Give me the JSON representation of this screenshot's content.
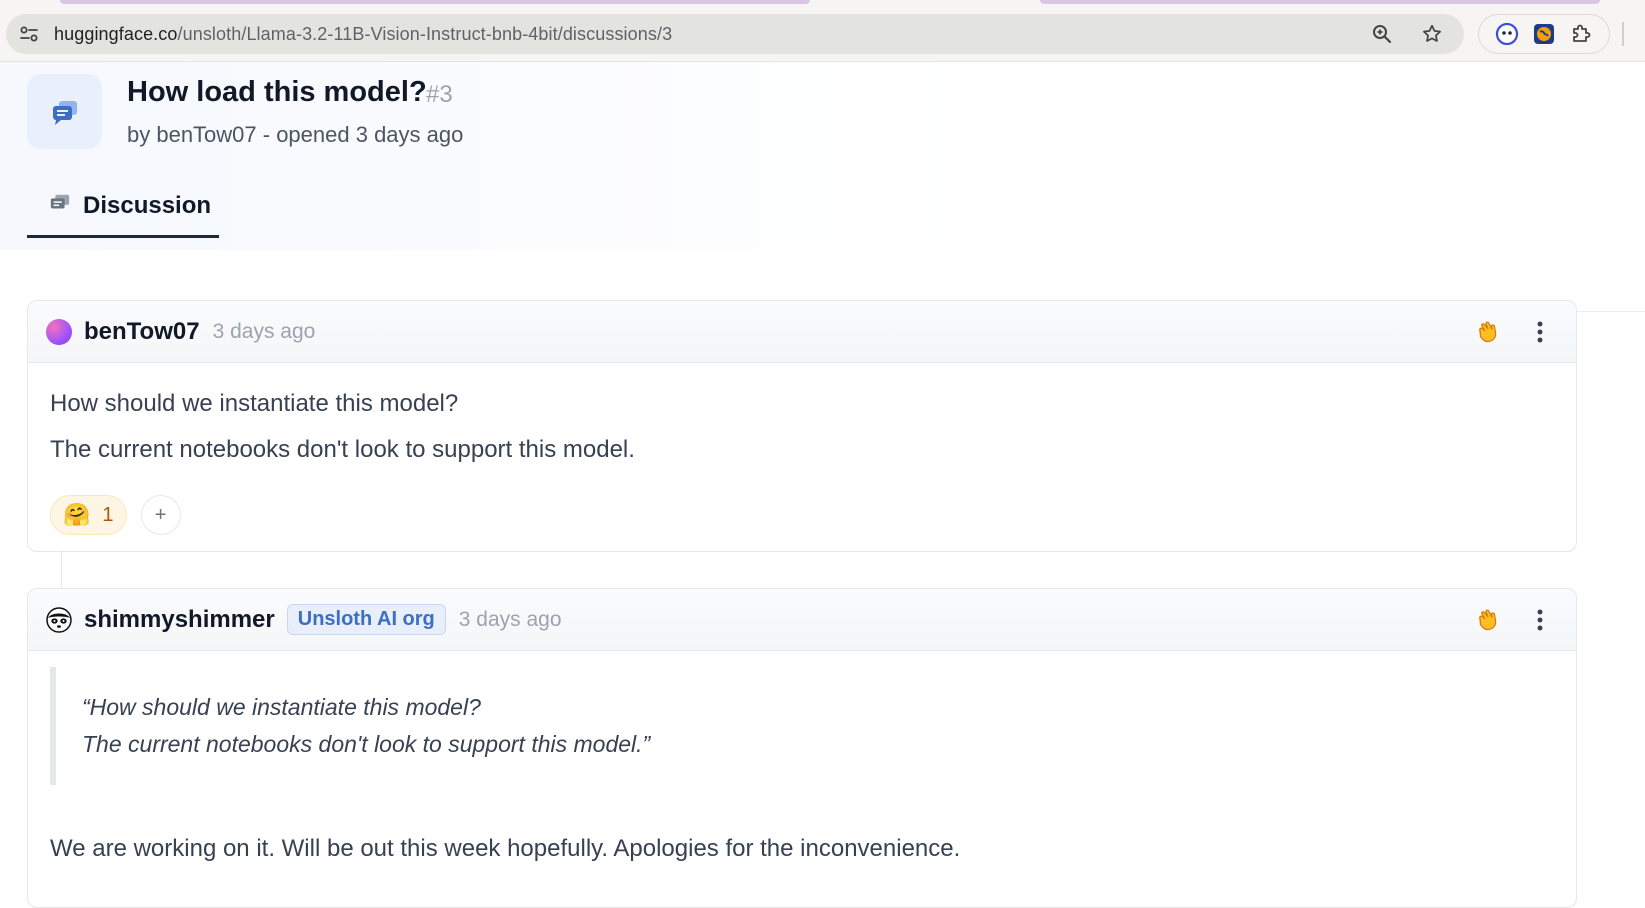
{
  "browser": {
    "url_host": "huggingface.co",
    "url_path": "/unsloth/Llama-3.2-11B-Vision-Instruct-bnb-4bit/discussions/3",
    "icons": [
      "site-info-icon",
      "zoom-icon",
      "bookmark-star-icon",
      "extension-face-icon",
      "extension-globe-icon",
      "extensions-puzzle-icon"
    ]
  },
  "discussion": {
    "title": "How load this model?",
    "number": "#3",
    "subtitle": "by benTow07 - opened 3 days ago",
    "tab_label": "Discussion"
  },
  "comments": [
    {
      "author": "benTow07",
      "time": "3 days ago",
      "lines": [
        "How should we instantiate this model?",
        "The current notebooks don't look to support this model."
      ],
      "reaction_emoji": "🤗",
      "reaction_count": "1",
      "add_reaction": "+"
    },
    {
      "author": "shimmyshimmer",
      "badge": "Unsloth AI org",
      "time": "3 days ago",
      "quote_lines": [
        "“How should we instantiate this model?",
        "The current notebooks don't look to support this model.”"
      ],
      "reply": "We are working on it. Will be out this week hopefully. Apologies for the inconvenience."
    }
  ],
  "colors": {
    "accent_blue": "#3b6fc4",
    "reaction_bg": "#fef6e4",
    "clap_orange": "#f59e0b"
  }
}
